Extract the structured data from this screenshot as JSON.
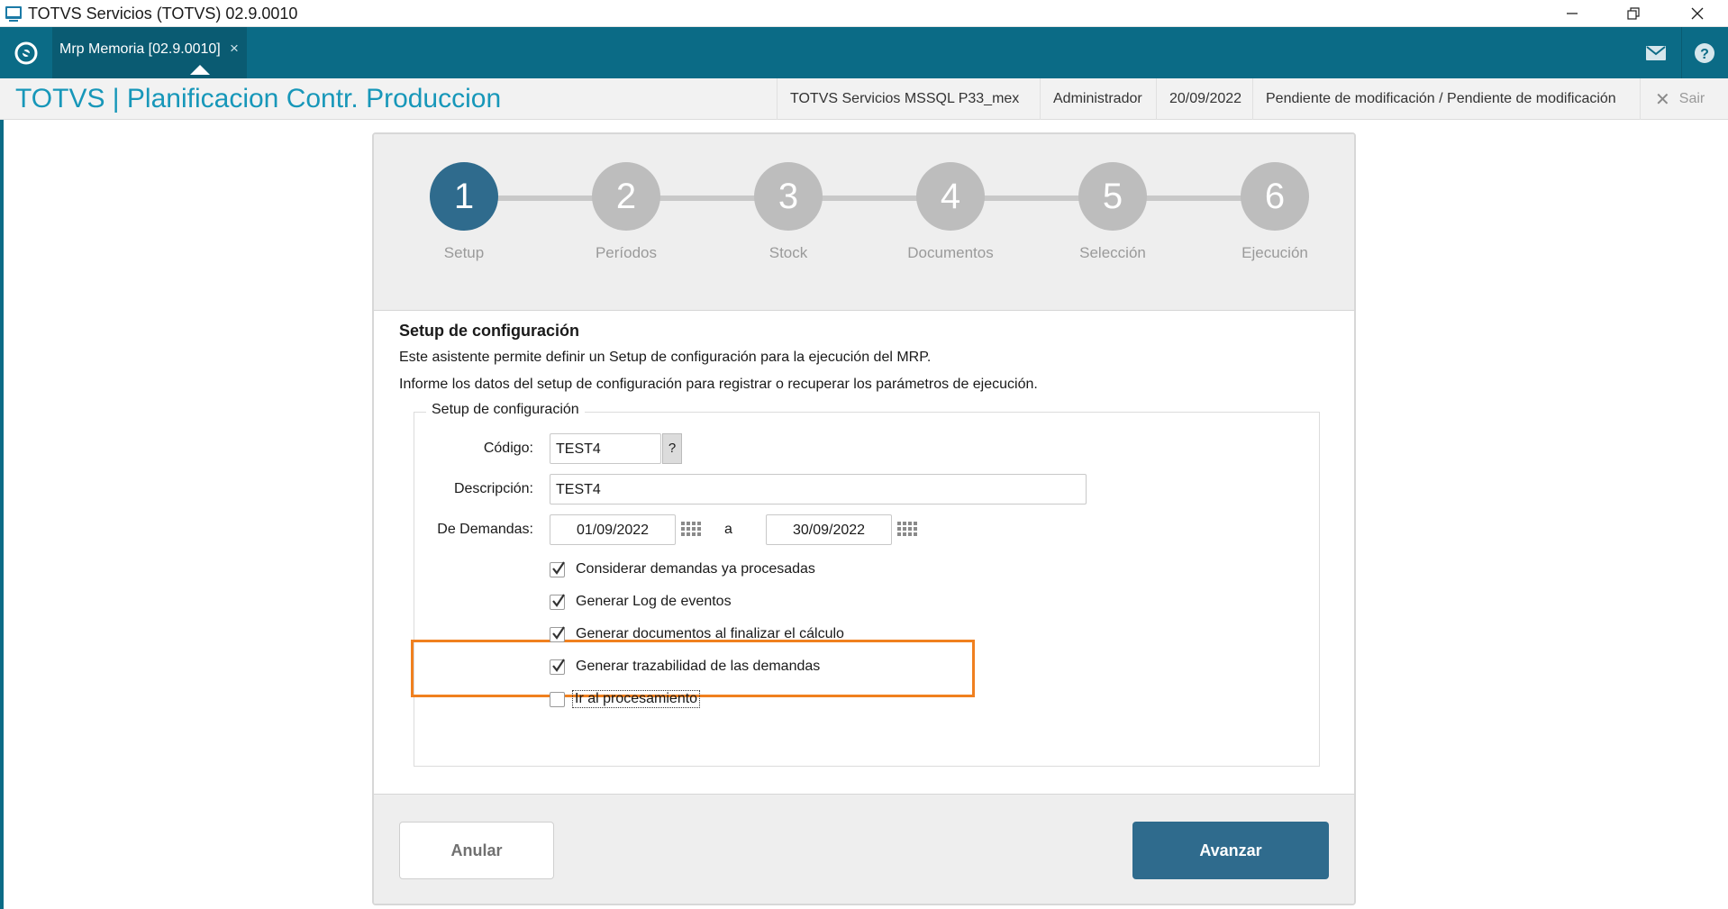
{
  "window": {
    "title": "TOTVS Servicios (TOTVS) 02.9.0010",
    "controls": [
      "minimize-icon",
      "restore-icon",
      "close-icon"
    ]
  },
  "appbar": {
    "home_icon": "totvs-logo-icon",
    "tab_label": "Mrp Memoria [02.9.0010]",
    "tab_close": "×",
    "mail_icon": "mail-icon",
    "help_icon": "help-icon"
  },
  "header": {
    "title": "TOTVS | Planificacion Contr. Produccion",
    "environment": "TOTVS Servicios MSSQL P33_mex",
    "user": "Administrador",
    "date": "20/09/2022",
    "status": "Pendiente de modificación / Pendiente de modificación",
    "exit_label": "Sair"
  },
  "wizard": {
    "active_step": 1,
    "steps": [
      {
        "number": "1",
        "label": "Setup"
      },
      {
        "number": "2",
        "label": "Períodos"
      },
      {
        "number": "3",
        "label": "Stock"
      },
      {
        "number": "4",
        "label": "Documentos"
      },
      {
        "number": "5",
        "label": "Selección"
      },
      {
        "number": "6",
        "label": "Ejecución"
      }
    ]
  },
  "section": {
    "title": "Setup de configuración",
    "desc1": "Este asistente permite definir un Setup de configuración para la ejecución del MRP.",
    "desc2": "Informe los datos del setup de configuración para registrar o recuperar los parámetros de ejecución.",
    "legend": "Setup de configuración"
  },
  "form": {
    "codigo_label": "Código:",
    "codigo_value": "TEST4",
    "codigo_help": "?",
    "descripcion_label": "Descripción:",
    "descripcion_value": "TEST4",
    "demandas_label": "De Demandas:",
    "date_from": "01/09/2022",
    "range_word": "a",
    "date_to": "30/09/2022"
  },
  "checkboxes": [
    {
      "label": "Considerar demandas ya procesadas",
      "checked": true
    },
    {
      "label": "Generar Log de eventos",
      "checked": true
    },
    {
      "label": "Generar documentos al finalizar el cálculo",
      "checked": true
    },
    {
      "label": "Generar trazabilidad de las demandas",
      "checked": true
    },
    {
      "label": "Ir al procesamiento",
      "checked": false
    }
  ],
  "buttons": {
    "cancel": "Anular",
    "next": "Avanzar"
  },
  "colors": {
    "appbar": "#0b6b86",
    "title_accent": "#1797b9",
    "active_step": "#2f6b8d",
    "inactive_step": "#bdbdbd",
    "highlight": "#f0801f"
  }
}
